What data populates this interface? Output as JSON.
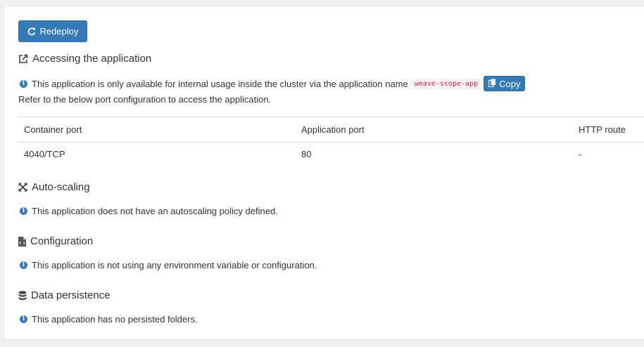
{
  "toolbar": {
    "redeploy_label": "Redeploy"
  },
  "accessing": {
    "title": "Accessing the application",
    "info_text": "This application is only available for internal usage inside the cluster via the application name",
    "app_name": "weave-scope-app",
    "copy_label": "Copy",
    "sub_text": "Refer to the below port configuration to access the application.",
    "table": {
      "headers": [
        "Container port",
        "Application port",
        "HTTP route"
      ],
      "rows": [
        [
          "4040/TCP",
          "80",
          "-"
        ]
      ]
    }
  },
  "autoscaling": {
    "title": "Auto-scaling",
    "info_text": "This application does not have an autoscaling policy defined."
  },
  "configuration": {
    "title": "Configuration",
    "info_text": "This application is not using any environment variable or configuration."
  },
  "persistence": {
    "title": "Data persistence",
    "info_text": "This application has no persisted folders."
  },
  "icons": {
    "redeploy": "redo-icon",
    "accessing": "external-link-icon",
    "info": "info-circle-icon",
    "copy": "copy-icon",
    "autoscaling": "expand-arrows-icon",
    "configuration": "file-code-icon",
    "persistence": "database-icon"
  },
  "colors": {
    "primary": "#337ab7",
    "code_text": "#c7254e",
    "code_bg": "#f9f2f4"
  }
}
